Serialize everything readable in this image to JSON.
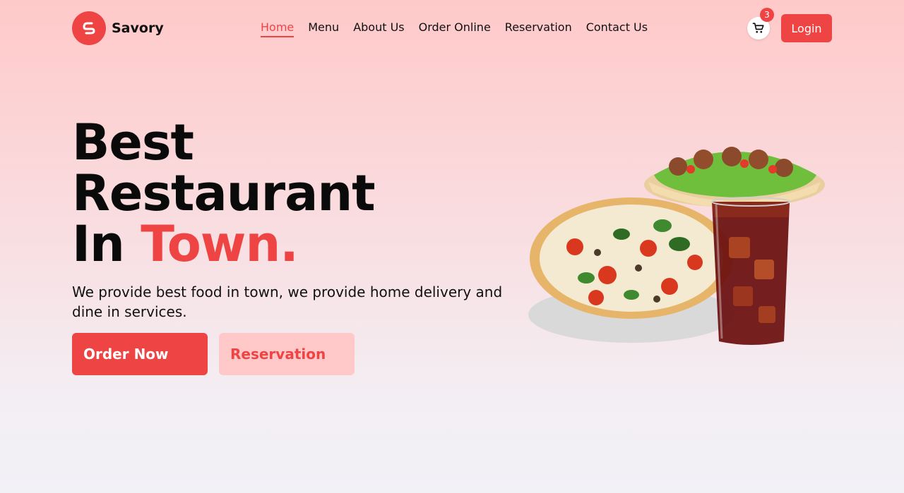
{
  "brand": {
    "name": "Savory",
    "logo_icon": "swirl-s-logo-icon",
    "accent_color": "#ef4444"
  },
  "nav": {
    "items": [
      {
        "label": "Home",
        "active": true
      },
      {
        "label": "Menu"
      },
      {
        "label": "About Us"
      },
      {
        "label": "Order Online"
      },
      {
        "label": "Reservation"
      },
      {
        "label": "Contact Us"
      }
    ]
  },
  "cart": {
    "icon": "shopping-cart-icon",
    "count": "3"
  },
  "header": {
    "login_label": "Login"
  },
  "hero": {
    "title_line1": "Best",
    "title_line2": "Restaurant",
    "title_line3_prefix": "In ",
    "title_line3_accent": "Town.",
    "description": "We provide best food in town, we provide home delivery and dine in services.",
    "primary_button": "Order Now",
    "secondary_button": "Reservation",
    "image": "pizza-sandwich-cola-image"
  }
}
